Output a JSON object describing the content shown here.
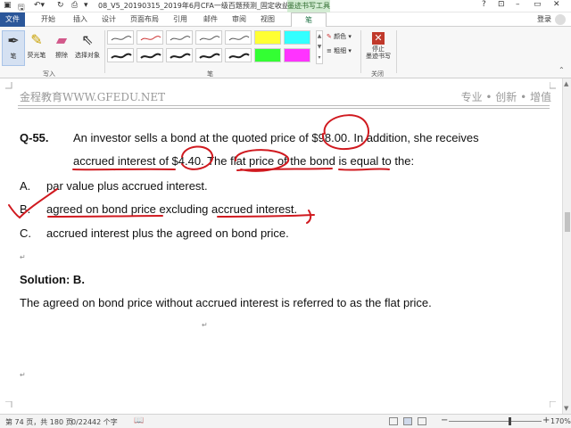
{
  "window": {
    "title": "08_V5_20190315_2019年6月CFA一级百题预测_固定收益（授...",
    "contextual_tab": "墨迹书写工具",
    "controls": [
      "?",
      "⊡",
      "–",
      "▭",
      "✕"
    ]
  },
  "tabs": {
    "file": "文件",
    "items": [
      "开始",
      "插入",
      "设计",
      "页面布局",
      "引用",
      "邮件",
      "审阅",
      "视图"
    ],
    "active": "笔",
    "login": "登录"
  },
  "ribbon": {
    "tools": [
      {
        "label": "笔",
        "icon": "pen-icon"
      },
      {
        "label": "荧光笔",
        "icon": "highlighter-icon"
      },
      {
        "label": "擦除",
        "icon": "eraser-icon"
      },
      {
        "label": "选择对象",
        "icon": "select-arrow-icon"
      }
    ],
    "color_label": "颜色",
    "weight_label": "粗细",
    "stop_label_1": "停止",
    "stop_label_2": "墨迹书写",
    "groups": {
      "write": "写入",
      "pens": "笔",
      "close": "关闭"
    },
    "highlight_colors": [
      "#ffff33",
      "#33ffff",
      "#ffffff",
      "#33ff33",
      "#ff33ff"
    ]
  },
  "document": {
    "header_left": "金程教育WWW.GFEDU.NET",
    "header_right": "专业 • 创新 • 增值",
    "question_number": "Q-55.",
    "question_line1": "An investor sells a bond at the quoted price of $98.00. In addition, she receives",
    "question_line2": "accrued interest of $4.40. The flat price of the bond is equal to the:",
    "options": [
      {
        "letter": "A.",
        "text": "par value plus accrued interest."
      },
      {
        "letter": "B.",
        "text": "agreed on bond price excluding accrued interest."
      },
      {
        "letter": "C.",
        "text": "accrued interest plus the agreed on bond price."
      }
    ],
    "solution_label": "Solution: B.",
    "solution_text": "The agreed on bond price without accrued interest is referred to as the flat price."
  },
  "status": {
    "page": "第 74 页，共 180 页",
    "words": "0/22442 个字",
    "zoom": "170%",
    "ink_color": "#d0191f"
  }
}
